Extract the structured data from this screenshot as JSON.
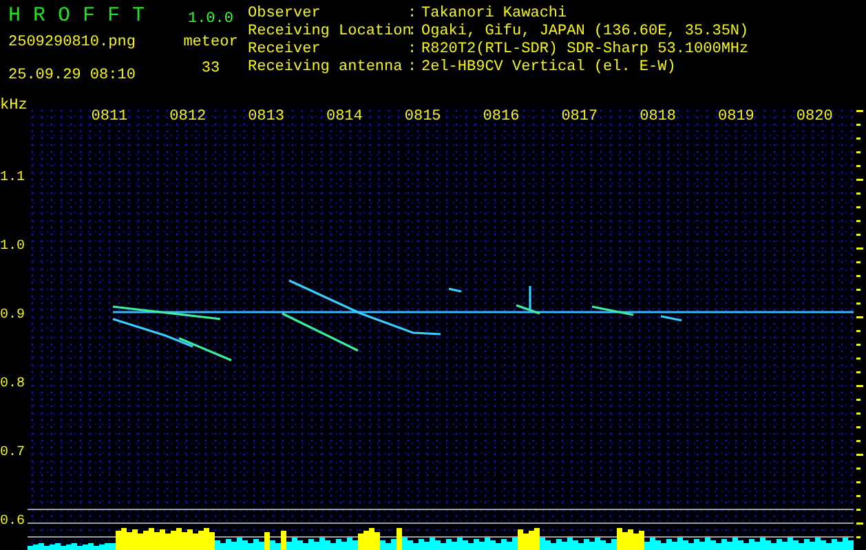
{
  "header": {
    "app_name": "H R O F F T",
    "version": "1.0.0",
    "filename": "2509290810.png",
    "datetime": "25.09.29 08:10",
    "meteor_label": "meteor",
    "meteor_count": "33"
  },
  "info": [
    {
      "label": "Observer",
      "separator": ":",
      "value": "Takanori Kawachi"
    },
    {
      "label": "Receiving Location",
      "separator": ":",
      "value": "Ogaki, Gifu, JAPAN (136.60E, 35.35N)"
    },
    {
      "label": "Receiver",
      "separator": ":",
      "value": "R820T2(RTL-SDR) SDR-Sharp 53.1000MHz"
    },
    {
      "label": "Receiving antenna",
      "separator": ":",
      "value": "2el-HB9CV Vertical (el. E-W)"
    }
  ],
  "y_axis": {
    "unit": "kHz",
    "labels": [
      "1.1",
      "1.0",
      "0.9",
      "0.8",
      "0.7",
      "0.6"
    ]
  },
  "time_labels": [
    "0811",
    "0812",
    "0813",
    "0814",
    "0815",
    "0816",
    "0817",
    "0818",
    "0819",
    "0820"
  ]
}
